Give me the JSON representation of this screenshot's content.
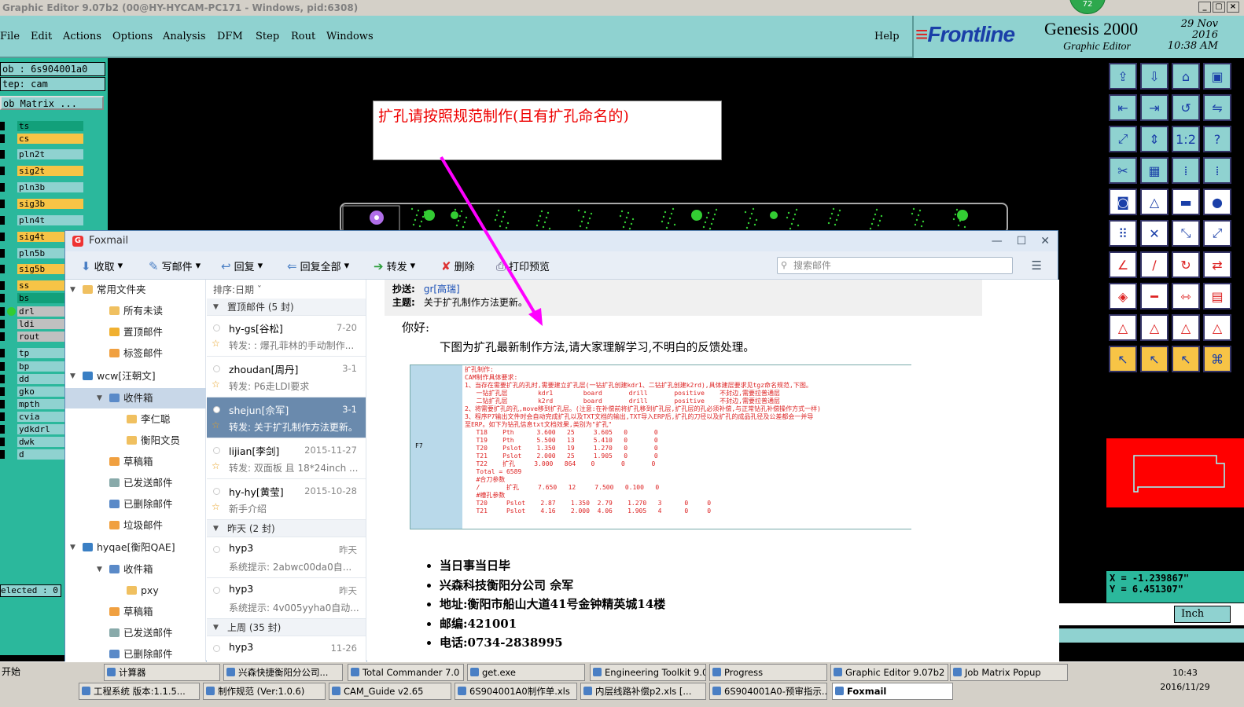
{
  "window": {
    "title": "Graphic Editor 9.07b2 (00@HY-HYCAM-PC171 - Windows, pid:6308)",
    "controls": [
      "_",
      "▢",
      "×"
    ]
  },
  "menu": [
    "File",
    "Edit",
    "Actions",
    "Options",
    "Analysis",
    "DFM",
    "Step",
    "Rout",
    "Windows"
  ],
  "help": "Help",
  "brand": {
    "logo": "Frontline",
    "product": "Genesis 2000",
    "sub": "Graphic Editor",
    "date": "29 Nov 2016",
    "time": "10:38 AM",
    "badge": "72"
  },
  "job": {
    "job": "ob : 6s904001a0",
    "step": "tep: cam",
    "matrix": "ob Matrix ..."
  },
  "layers": [
    {
      "name": "ts",
      "color": "#12a07a"
    },
    {
      "name": "cs",
      "color": "#f7c446"
    },
    {
      "name": "pln2t",
      "color": "#8fd2d0"
    },
    {
      "name": "sig2t",
      "color": "#f7c446"
    },
    {
      "name": "pln3b",
      "color": "#8fd2d0"
    },
    {
      "name": "sig3b",
      "color": "#f7c446"
    },
    {
      "name": "pln4t",
      "color": "#8fd2d0"
    },
    {
      "name": "sig4t",
      "color": "#f7c446"
    },
    {
      "name": "pln5b",
      "color": "#8fd2d0"
    },
    {
      "name": "sig5b",
      "color": "#f7c446"
    },
    {
      "name": "ss",
      "color": "#f7c446"
    },
    {
      "name": "bs",
      "color": "#12a07a"
    },
    {
      "name": "drl",
      "color": "#c0c0c0"
    },
    {
      "name": "ldi",
      "color": "#c0c0c0"
    },
    {
      "name": "rout",
      "color": "#c0c0c0"
    },
    {
      "name": "tp",
      "color": "#8fd2d0"
    },
    {
      "name": "bp",
      "color": "#8fd2d0"
    },
    {
      "name": "dd",
      "color": "#8fd2d0"
    },
    {
      "name": "gko",
      "color": "#8fd2d0"
    },
    {
      "name": "mpth",
      "color": "#8fd2d0"
    },
    {
      "name": "cvia",
      "color": "#8fd2d0"
    },
    {
      "name": "ydkdrl",
      "color": "#8fd2d0"
    },
    {
      "name": "dwk",
      "color": "#8fd2d0"
    },
    {
      "name": "d",
      "color": "#8fd2d0"
    }
  ],
  "selected": "elected : 0",
  "coords": {
    "x": "X = -1.239867\"",
    "y": "Y = 6.451307\""
  },
  "units": "Inch",
  "annotation": "扩孔请按照规范制作(且有扩孔命名的)",
  "foxmail": {
    "title": "Foxmail",
    "toolbar": [
      "收取",
      "写邮件",
      "回复",
      "回复全部",
      "转发",
      "删除",
      "打印预览"
    ],
    "search_placeholder": "搜索邮件",
    "folders": [
      {
        "label": "常用文件夹",
        "indent": 0,
        "color": "#f0c060"
      },
      {
        "label": "所有未读",
        "indent": 1,
        "color": "#f0c060"
      },
      {
        "label": "置顶邮件",
        "indent": 1,
        "color": "#f0b030"
      },
      {
        "label": "标签邮件",
        "indent": 1,
        "color": "#f0a040"
      },
      {
        "label": "wcw[汪朝文]",
        "indent": 0,
        "color": "#3a7fc4"
      },
      {
        "label": "收件箱",
        "indent": 1,
        "color": "#5a8ac8"
      },
      {
        "label": "李仁聪",
        "indent": 2,
        "color": "#f0c060"
      },
      {
        "label": "衡阳文员",
        "indent": 2,
        "color": "#f0c060"
      },
      {
        "label": "草稿箱",
        "indent": 1,
        "color": "#f0a040"
      },
      {
        "label": "已发送邮件",
        "indent": 1,
        "color": "#8aa"
      },
      {
        "label": "已删除邮件",
        "indent": 1,
        "color": "#5a8ac8"
      },
      {
        "label": "垃圾邮件",
        "indent": 1,
        "color": "#f0a040"
      },
      {
        "label": "hyqae[衡阳QAE]",
        "indent": 0,
        "color": "#3a7fc4"
      },
      {
        "label": "收件箱",
        "indent": 1,
        "color": "#5a8ac8"
      },
      {
        "label": "pxy",
        "indent": 2,
        "color": "#f0c060"
      },
      {
        "label": "草稿箱",
        "indent": 1,
        "color": "#f0a040"
      },
      {
        "label": "已发送邮件",
        "indent": 1,
        "color": "#8aa"
      },
      {
        "label": "已删除邮件",
        "indent": 1,
        "color": "#5a8ac8"
      }
    ],
    "sort": "排序:日期",
    "groups": {
      "top": "置顶邮件 (5 封)",
      "yesterday": "昨天 (2 封)",
      "lastweek": "上周 (35 封)"
    },
    "messages": [
      {
        "from": "hy-gs[谷松]",
        "date": "7-20",
        "subject": "转发: : 爆孔菲林的手动制作..."
      },
      {
        "from": "zhoudan[周丹]",
        "date": "3-1",
        "subject": "转发: P6走LDI要求"
      },
      {
        "from": "shejun[佘军]",
        "date": "3-1",
        "subject": "转发: 关于扩孔制作方法更新。"
      },
      {
        "from": "lijian[李剑]",
        "date": "2015-11-27",
        "subject": "转发: 双面板 且 18*24inch ..."
      },
      {
        "from": "hy-hy[黄莹]",
        "date": "2015-10-28",
        "subject": "新手介绍"
      },
      {
        "from": "hyp3",
        "date": "昨天",
        "subject": "系统提示: 2abwc00da0自..."
      },
      {
        "from": "hyp3",
        "date": "昨天",
        "subject": "系统提示: 4v005yyha0自动..."
      },
      {
        "from": "hyp3",
        "date": "11-26",
        "subject": ""
      }
    ],
    "reader": {
      "cc_label": "抄送:",
      "cc": "gr[高瑞]",
      "subj_label": "主题:",
      "subject": "关于扩孔制作方法更新。",
      "greeting": "你好:",
      "intro": "下图为扩孔最新制作方法,请大家理解学习,不明白的反馈处理。",
      "embedded": "扩孔制作:\nCAM制作具体要求:\n1、当存在需要扩孔的孔时,需要建立扩孔层(一钻扩孔创建kdr1、二钻扩孔创建k2rd),具体建层要求见tgz命名规范,下图。\n   一钻扩孔层        kdr1        board       drill       positive    不封边,需要拉普通层\n   二钻扩孔层        k2rd        board       drill       positive    不封边,需要拉普通层\n2、将需要扩孔的孔,move移到扩孔层。(注意:在补偿前将扩孔移到扩孔层,扩孔层的孔必须补偿,与正常钻孔补偿操作方式一样)\n3、程序P7输出文件时会自动完成扩孔以及TXT文档的输出,TXT导入ERP后,扩孔的刀径以及扩孔的成品孔径及公差都会一并导\n至ERP。如下为钻孔信息txt文档效果,类别为\"扩孔\"\n   T18    Pth      3.600   25     3.605   0       0\n   T19    Pth      5.500   13     5.410   0       0\n   T20    Pslot    1.350   19     1.270   0       0\n   T21    Pslot    2.000   25     1.905   0       0\n   T22    扩孔     3.000   864    0       0       0\n   Total = 6589\n   #合刀参数\n   /       扩孔     7.650   12     7.500   0.100   0\n   #槽孔参数\n   T20     Pslot    2.87    1.350  2.79    1.270   3      0     0\n   T21     Pslot    4.16    2.000  4.06    1.905   4      0     0",
      "f7": "F7",
      "signature": [
        "当日事当日毕",
        "兴森科技衡阳分公司 佘军",
        "地址:衡阳市船山大道41号金钟精英城14楼",
        "邮编:421001",
        "电话:0734-2838995"
      ]
    }
  },
  "taskbar": {
    "start": "开始",
    "row1": [
      "计算器",
      "兴森快捷衡阳分公司...",
      "Total Commander 7.0 p...",
      "get.exe",
      "Engineering Toolkit 9.0...",
      "Progress",
      "Graphic Editor 9.07b2 (...",
      "Job Matrix Popup"
    ],
    "row2": [
      "工程系统  版本:1.1.5...",
      "制作规范 (Ver:1.0.6)",
      "CAM_Guide v2.65",
      "6S904001A0制作单.xls",
      "内层线路补偿p2.xls [...",
      "6S904001A0-预审指示...",
      "Foxmail"
    ],
    "time": "10:43",
    "date": "2016/11/29"
  }
}
